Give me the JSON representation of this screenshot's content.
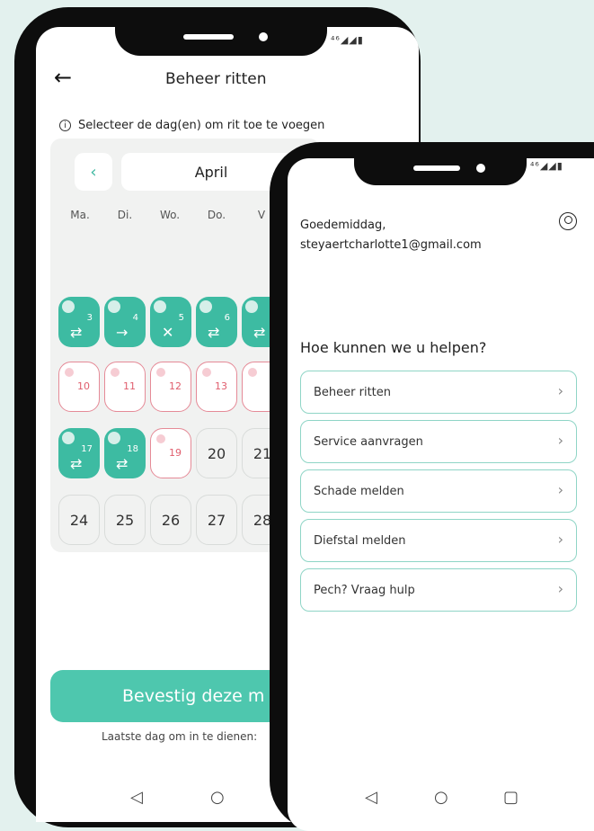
{
  "back_screen": {
    "title": "Beheer ritten",
    "hint": "Selecteer de dag(en) om rit toe te voegen",
    "month": "April",
    "prev_month_glyph": "‹",
    "weekdays": [
      "Ma.",
      "Di.",
      "Wo.",
      "Do.",
      "V"
    ],
    "row1": [
      {
        "num": "3",
        "sym": "⇄"
      },
      {
        "num": "4",
        "sym": "→"
      },
      {
        "num": "5",
        "sym": "✕"
      },
      {
        "num": "6",
        "sym": "⇄"
      },
      {
        "num": "",
        "sym": "⇄"
      }
    ],
    "row2": [
      "10",
      "11",
      "12",
      "13",
      ""
    ],
    "row3_ride": [
      {
        "num": "17",
        "sym": "⇄"
      },
      {
        "num": "18",
        "sym": "⇄"
      }
    ],
    "row3_open": "19",
    "row3_plain": [
      "20",
      "21"
    ],
    "row4": [
      "24",
      "25",
      "26",
      "27",
      "28"
    ],
    "confirm_label": "Bevestig deze m",
    "deadline": "Laatste dag om in te dienen:",
    "status": "⁴⁶◢◢▮"
  },
  "front_screen": {
    "greeting": "Goedemiddag,",
    "email": "steyaertcharlotte1@gmail.com",
    "help_title": "Hoe kunnen we u helpen?",
    "menu": [
      "Beheer ritten",
      "Service aanvragen",
      "Schade melden",
      "Diefstal melden",
      "Pech? Vraag hulp"
    ],
    "status": "⁴⁶◢◢▮"
  },
  "nav": {
    "back": "◁",
    "home": "○",
    "recent": "▢"
  },
  "icons": {
    "arrow_left": "←",
    "chevron_right": "›",
    "info": "i"
  },
  "colors": {
    "accent": "#3dbba2",
    "open_border": "#e58a97",
    "background": "#e3f1ee"
  }
}
